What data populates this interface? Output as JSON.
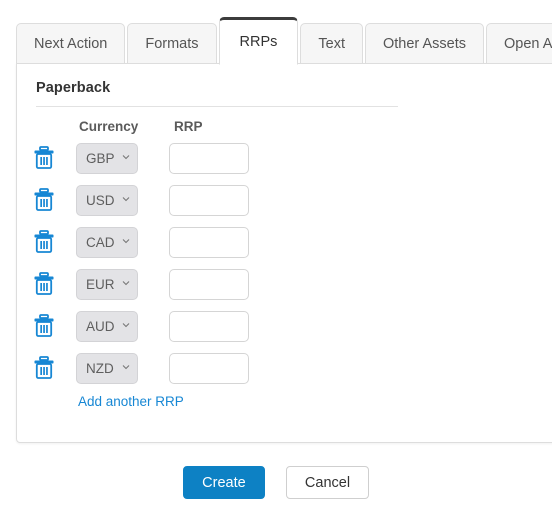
{
  "colors": {
    "accent": "#1787d4",
    "primary_button": "#0d81c4",
    "active_tab_indicator": "#3c3c3c",
    "trash_icon": "#1787d4",
    "select_background": "#e3e3e6",
    "panel_border": "#dddddd"
  },
  "tabs": [
    {
      "label": "Next Action",
      "active": false
    },
    {
      "label": "Formats",
      "active": false
    },
    {
      "label": "RRPs",
      "active": true
    },
    {
      "label": "Text",
      "active": false
    },
    {
      "label": "Other Assets",
      "active": false
    },
    {
      "label": "Open Access",
      "active": false
    }
  ],
  "panel": {
    "section_title": "Paperback",
    "columns": {
      "currency": "Currency",
      "rrp": "RRP"
    },
    "rows": [
      {
        "currency": "GBP",
        "rrp": "",
        "rrp_placeholder": "",
        "delete_icon": "trash-icon"
      },
      {
        "currency": "USD",
        "rrp": "",
        "rrp_placeholder": "",
        "delete_icon": "trash-icon"
      },
      {
        "currency": "CAD",
        "rrp": "",
        "rrp_placeholder": "",
        "delete_icon": "trash-icon"
      },
      {
        "currency": "EUR",
        "rrp": "",
        "rrp_placeholder": "",
        "delete_icon": "trash-icon"
      },
      {
        "currency": "AUD",
        "rrp": "",
        "rrp_placeholder": "",
        "delete_icon": "trash-icon"
      },
      {
        "currency": "NZD",
        "rrp": "",
        "rrp_placeholder": "",
        "delete_icon": "trash-icon"
      }
    ],
    "add_link": "Add another RRP"
  },
  "footer": {
    "create_label": "Create",
    "cancel_label": "Cancel"
  },
  "icons": {
    "chevron_down": "chevron-down-icon",
    "trash": "trash-icon"
  }
}
